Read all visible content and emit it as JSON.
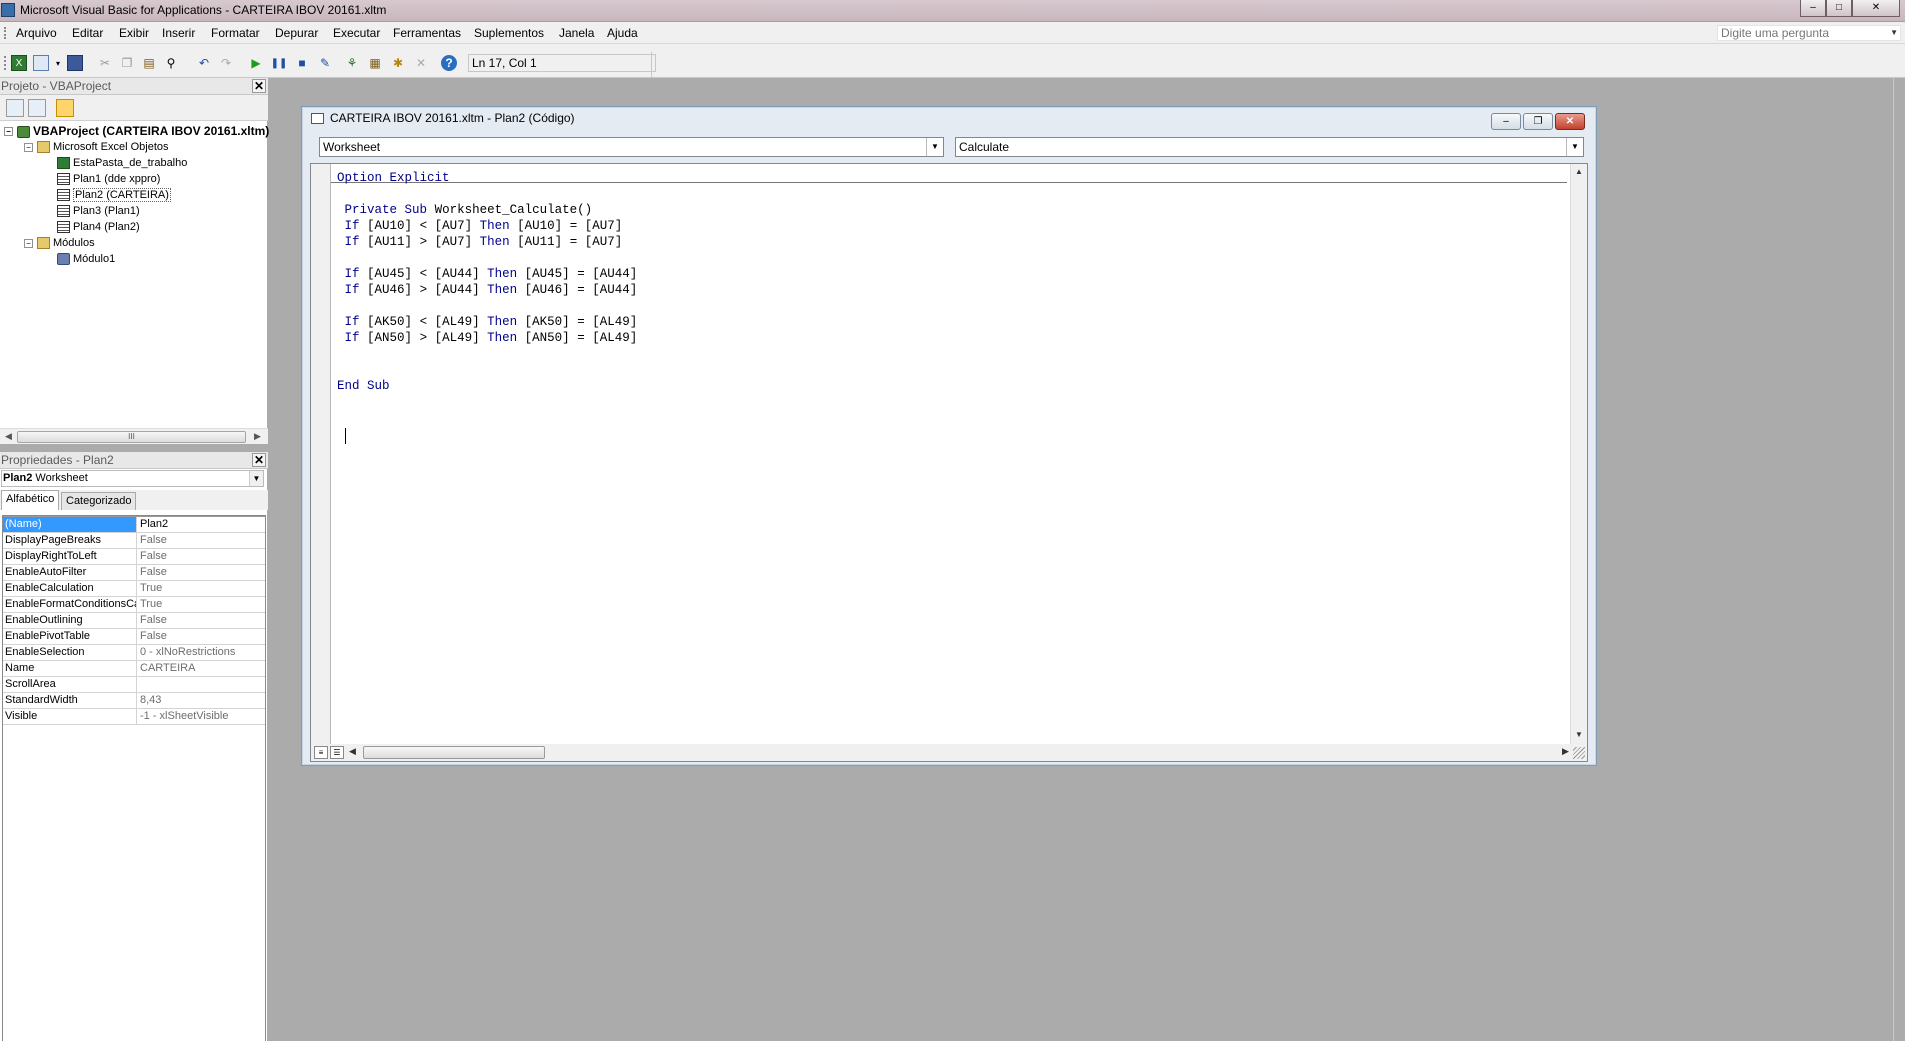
{
  "app": {
    "title": "Microsoft Visual Basic for Applications - CARTEIRA IBOV 20161.xltm",
    "window_buttons": [
      "–",
      "□",
      "✕"
    ]
  },
  "menu": {
    "items": [
      "Arquivo",
      "Editar",
      "Exibir",
      "Inserir",
      "Formatar",
      "Depurar",
      "Executar",
      "Ferramentas",
      "Suplementos",
      "Janela",
      "Ajuda"
    ],
    "ask_placeholder": "Digite uma pergunta"
  },
  "toolbar": {
    "position": "Ln 17, Col 1",
    "icons": [
      "excel-icon",
      "insert-icon",
      "save-icon",
      "cut-icon",
      "copy-icon",
      "paste-icon",
      "find-icon",
      "undo-icon",
      "redo-icon",
      "run-icon",
      "break-icon",
      "reset-icon",
      "design-mode-icon",
      "project-explorer-icon",
      "properties-icon",
      "object-browser-icon",
      "toolbox-icon",
      "help-icon"
    ]
  },
  "project_panel": {
    "title": "Projeto - VBAProject",
    "tree": [
      {
        "label": "VBAProject (CARTEIRA IBOV 20161.xltm)",
        "level": 0,
        "icon": "vba-project-icon",
        "expander": "−"
      },
      {
        "label": "Microsoft Excel Objetos",
        "level": 1,
        "icon": "folder-icon",
        "expander": "−"
      },
      {
        "label": "EstaPasta_de_trabalho",
        "level": 2,
        "icon": "workbook-icon"
      },
      {
        "label": "Plan1 (dde xppro)",
        "level": 2,
        "icon": "sheet-icon"
      },
      {
        "label": "Plan2 (CARTEIRA)",
        "level": 2,
        "icon": "sheet-icon",
        "selected": true
      },
      {
        "label": "Plan3 (Plan1)",
        "level": 2,
        "icon": "sheet-icon"
      },
      {
        "label": "Plan4 (Plan2)",
        "level": 2,
        "icon": "sheet-icon"
      },
      {
        "label": "Módulos",
        "level": 1,
        "icon": "folder-icon",
        "expander": "−"
      },
      {
        "label": "Módulo1",
        "level": 2,
        "icon": "module-icon"
      }
    ],
    "scroll_grip": "III"
  },
  "props_panel": {
    "title": "Propriedades - Plan2",
    "object_name": "Plan2",
    "object_type": "Worksheet",
    "tabs": [
      "Alfabético",
      "Categorizado"
    ],
    "rows": [
      {
        "name": "(Name)",
        "value": "Plan2",
        "selected": true
      },
      {
        "name": "DisplayPageBreaks",
        "value": "False"
      },
      {
        "name": "DisplayRightToLeft",
        "value": "False"
      },
      {
        "name": "EnableAutoFilter",
        "value": "False"
      },
      {
        "name": "EnableCalculation",
        "value": "True"
      },
      {
        "name": "EnableFormatConditionsCal",
        "value": "True"
      },
      {
        "name": "EnableOutlining",
        "value": "False"
      },
      {
        "name": "EnablePivotTable",
        "value": "False"
      },
      {
        "name": "EnableSelection",
        "value": "0 - xlNoRestrictions"
      },
      {
        "name": "Name",
        "value": "CARTEIRA"
      },
      {
        "name": "ScrollArea",
        "value": ""
      },
      {
        "name": "StandardWidth",
        "value": "8,43"
      },
      {
        "name": "Visible",
        "value": "-1 - xlSheetVisible"
      }
    ]
  },
  "code_window": {
    "title": "CARTEIRA IBOV 20161.xltm - Plan2 (Código)",
    "object_combo": "Worksheet",
    "procedure_combo": "Calculate",
    "lines": [
      "Option Explicit",
      "",
      " Private Sub Worksheet_Calculate()",
      " If [AU10] < [AU7] Then [AU10] = [AU7]",
      " If [AU11] > [AU7] Then [AU11] = [AU7]",
      "",
      " If [AU45] < [AU44] Then [AU45] = [AU44]",
      " If [AU46] > [AU44] Then [AU46] = [AU44]",
      "",
      " If [AK50] < [AL49] Then [AK50] = [AL49]",
      " If [AN50] > [AL49] Then [AN50] = [AL49]",
      "",
      "",
      "End Sub",
      "",
      "",
      ""
    ],
    "keywords": [
      "Option",
      "Explicit",
      "Private",
      "Sub",
      "If",
      "Then",
      "End"
    ]
  }
}
